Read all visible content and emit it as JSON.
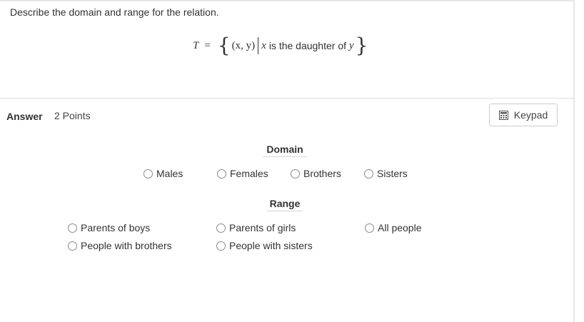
{
  "question": {
    "text": "Describe the domain and range for the relation.",
    "formula": {
      "lhs": "T",
      "equals": "=",
      "open_brace": "{",
      "pair": "(x, y)",
      "var_x": "x",
      "condition": "is the daughter of",
      "var_y": "y",
      "close_brace": "}"
    }
  },
  "answer": {
    "label": "Answer",
    "points": "2 Points",
    "keypad_label": "Keypad"
  },
  "domain": {
    "title": "Domain",
    "options": [
      "Males",
      "Females",
      "Brothers",
      "Sisters"
    ]
  },
  "range": {
    "title": "Range",
    "options": [
      "Parents of boys",
      "People with brothers",
      "Parents of girls",
      "People with sisters",
      "All people"
    ]
  },
  "colors": {
    "text": "#333333",
    "border": "#dddddd"
  },
  "icons": {
    "keypad": "calculator-icon",
    "radio": "radio-unchecked"
  }
}
